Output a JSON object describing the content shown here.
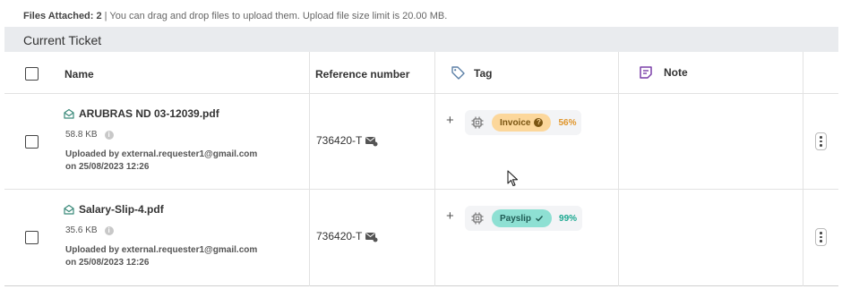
{
  "info_bar": {
    "label": "Files Attached: 2",
    "text": " | You can drag and drop files to upload them. Upload file size limit is 20.00 MB."
  },
  "section": {
    "title": "Current Ticket"
  },
  "columns": {
    "name": "Name",
    "reference": "Reference number",
    "tag": "Tag",
    "note": "Note"
  },
  "files": [
    {
      "name": "ARUBRAS ND 03-12039.pdf",
      "size": "58.8 KB",
      "uploaded_line1": "Uploaded by external.requester1@gmail.com",
      "uploaded_line2": "on 25/08/2023 12:26",
      "reference": "736420-T",
      "tag": "Invoice",
      "confidence": "56%",
      "confidence_color": "#e0952a"
    },
    {
      "name": "Salary-Slip-4.pdf",
      "size": "35.6 KB",
      "uploaded_line1": "Uploaded by external.requester1@gmail.com",
      "uploaded_line2": "on 25/08/2023 12:26",
      "reference": "736420-T",
      "tag": "Payslip",
      "confidence": "99%",
      "confidence_color": "#1aa890"
    }
  ],
  "icons": {
    "tag_header": "tag-icon",
    "note_header": "note-icon",
    "file": "envelope-open-icon",
    "reference": "mail-icon",
    "ai": "chip-icon",
    "info": "info-icon",
    "more": "kebab-menu-icon"
  }
}
